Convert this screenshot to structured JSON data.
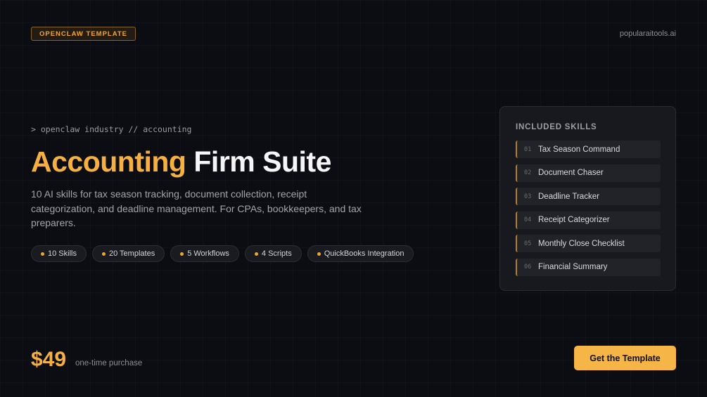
{
  "header": {
    "badge": "OPENCLAW TEMPLATE",
    "site": "popularaitools.ai"
  },
  "hero": {
    "command": "> openclaw industry // accounting",
    "title_accent": "Accounting",
    "title_rest": "Firm Suite",
    "description": "10 AI skills for tax season tracking, document collection, receipt categorization, and deadline management. For CPAs, bookkeepers, and tax preparers.",
    "tags": [
      "10 Skills",
      "20 Templates",
      "5 Workflows",
      "4 Scripts",
      "QuickBooks Integration"
    ]
  },
  "skills_panel": {
    "title": "INCLUDED SKILLS",
    "items": [
      {
        "num": "01",
        "label": "Tax Season Command"
      },
      {
        "num": "02",
        "label": "Document Chaser"
      },
      {
        "num": "03",
        "label": "Deadline Tracker"
      },
      {
        "num": "04",
        "label": "Receipt Categorizer"
      },
      {
        "num": "05",
        "label": "Monthly Close Checklist"
      },
      {
        "num": "06",
        "label": "Financial Summary"
      }
    ]
  },
  "footer": {
    "price": "$49",
    "price_note": "one-time purchase",
    "cta_label": "Get the Template"
  },
  "colors": {
    "accent": "#f5b041",
    "background": "#0c0d12",
    "panel": "#18191e"
  }
}
